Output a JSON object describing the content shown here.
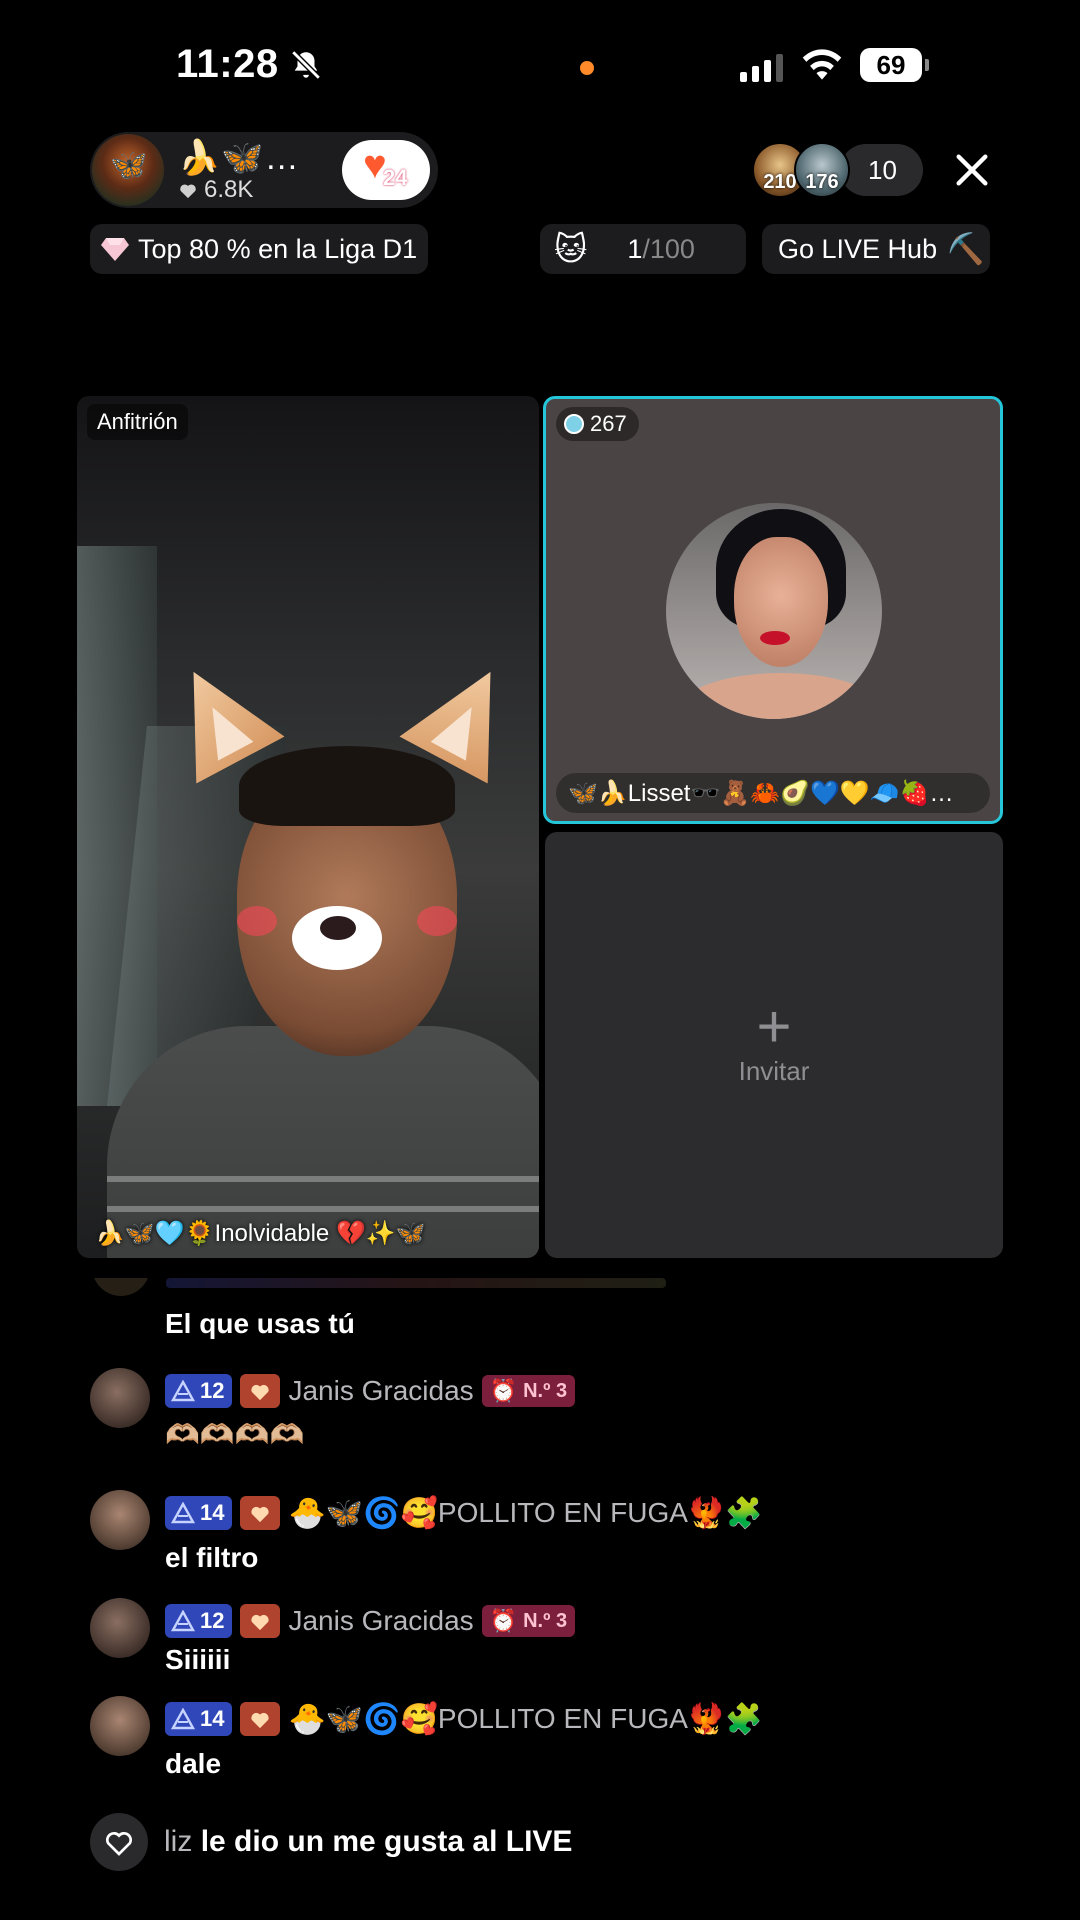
{
  "status_bar": {
    "time": "11:28",
    "battery": "69"
  },
  "header": {
    "host_name": "🍌🦋…",
    "host_likes": "6.8K",
    "follow_badge_count": "24",
    "viewer_1_count": "210",
    "viewer_2_count": "176",
    "viewer_total": "10"
  },
  "chips": {
    "league": "Top 80 % en la Liga D1",
    "goal_current": "1",
    "goal_total": "/100",
    "hub": "Go LIVE Hub"
  },
  "host_tile": {
    "label": "Anfitrión",
    "name": "🍌🦋🩵🌻Inolvidable 💔✨🦋"
  },
  "guest_tile": {
    "score": "267",
    "name": "🦋🍌Lisset🕶️🧸🦀🥑💙💛🧢🍓…"
  },
  "invite": {
    "plus": "+",
    "label": "Invitar"
  },
  "chat": {
    "first_text": "El que usas tú",
    "messages": [
      {
        "level": "12",
        "user": "Janis Gracidas",
        "rank": "N.º 3",
        "text": "🫶🏼🫶🏼🫶🏼🫶🏼"
      },
      {
        "level": "14",
        "user": "POLLITO EN FUGA",
        "prefix_emojis": "🐣🦋🌀🥰",
        "suffix_emojis": "🐦‍🔥🧩",
        "text": "el filtro"
      },
      {
        "level": "12",
        "user": "Janis Gracidas",
        "rank": "N.º 3",
        "text": "Siiiiii"
      },
      {
        "level": "14",
        "user": "POLLITO EN FUGA",
        "prefix_emojis": "🐣🦋🌀🥰",
        "suffix_emojis": "🐦‍🔥🧩",
        "text": "dale"
      }
    ],
    "like_notice_user": "liz",
    "like_notice_text": "le dio un me gusta al LIVE"
  },
  "colors": {
    "guest_border": "#25c6da",
    "level_badge": "#2f47b8",
    "rank_badge": "#7b1f3c",
    "fan_badge": "#b0432e"
  }
}
